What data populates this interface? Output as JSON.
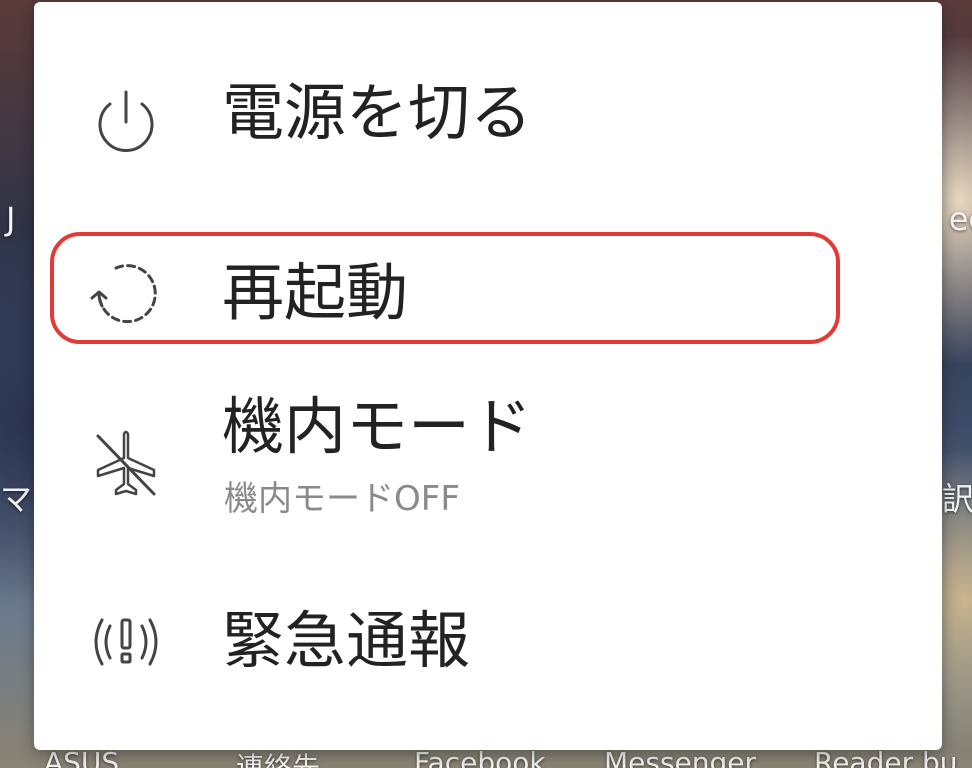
{
  "background": {
    "left_top_label": "J",
    "right_top_label": "ec",
    "left_mid_label": "マ",
    "right_mid_label": "訳",
    "dock_labels": [
      "ASUS",
      "連絡先",
      "Facebook",
      "Messenger",
      "Reader bu"
    ]
  },
  "power_menu": {
    "items": [
      {
        "icon": "power-icon",
        "label": "電源を切る"
      },
      {
        "icon": "restart-icon",
        "label": "再起動",
        "highlighted": true
      },
      {
        "icon": "airplane-off-icon",
        "label": "機内モード",
        "sublabel": "機内モードOFF"
      },
      {
        "icon": "emergency-icon",
        "label": "緊急通報"
      }
    ]
  },
  "colors": {
    "menu_background": "#ffffff",
    "label_text": "#222222",
    "sublabel_text": "#8a8a8a",
    "icon_stroke": "#444444",
    "highlight_outline": "#e53935"
  }
}
